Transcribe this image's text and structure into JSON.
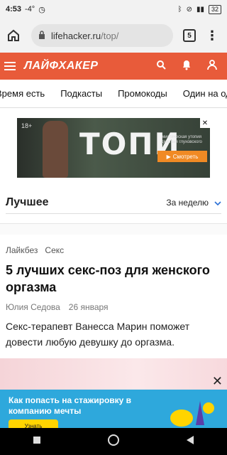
{
  "status_bar": {
    "time": "4:53",
    "temp": "-4°",
    "battery": "32"
  },
  "browser": {
    "url_host": "lifehacker.ru",
    "url_path": "/top/",
    "tab_count": "5"
  },
  "site": {
    "logo": "ЛАЙФХАКЕР",
    "nav_items": [
      "Время есть",
      "Подкасты",
      "Промокоды",
      "Один на один"
    ]
  },
  "ad_banner": {
    "age": "18+",
    "title": "ТОПИ",
    "subtitle": "мистическая утопия дмитрия глуховского",
    "cta": "Смотреть"
  },
  "best_section": {
    "title": "Лучшее",
    "period": "За неделю"
  },
  "article": {
    "tags": [
      "Лайкбез",
      "Секс"
    ],
    "headline": "5 лучших секс-поз для женского оргазма",
    "author": "Юлия Седова",
    "date": "26 января",
    "lead": "Секс-терапевт Ванесса Марин поможет довести любую девушку до оргазма."
  },
  "promo_banner": {
    "text": "Как попасть на стажировку в компанию мечты",
    "cta": "Узнать"
  },
  "colors": {
    "brand": "#e85b3a",
    "promo": "#2ea8dc"
  }
}
